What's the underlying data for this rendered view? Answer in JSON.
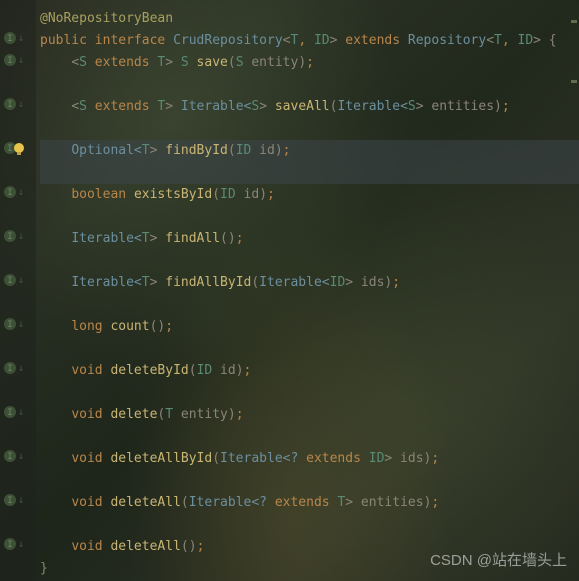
{
  "annotation": "@NoRepositoryBean",
  "decl": {
    "public": "public",
    "interface": "interface",
    "name": "CrudRepository",
    "lt": "<",
    "t": "T",
    "comma": ", ",
    "id": "ID",
    "gt": ">",
    "extends": " extends ",
    "parent": "Repository",
    "brace": " {"
  },
  "methods": {
    "save": {
      "prefix": "<",
      "s": "S",
      "ext": " extends ",
      "t": "T",
      "gt": "> ",
      "ret": "S",
      "name": " save",
      "lp": "(",
      "ptype": "S",
      "pname": " entity",
      "rp": ")",
      "semi": ";"
    },
    "saveAll": {
      "prefix": "<",
      "s": "S",
      "ext": " extends ",
      "t": "T",
      "gt": "> ",
      "ret": "Iterable<",
      "rs": "S",
      "rgt": "> ",
      "name": "saveAll",
      "lp": "(",
      "ptype": "Iterable<",
      "ps": "S",
      "pgt": ">",
      "pname": " entities",
      "rp": ")",
      "semi": ";"
    },
    "findById": {
      "ret": "Optional<",
      "t": "T",
      "gt": "> ",
      "name": "findById",
      "lp": "(",
      "ptype": "ID",
      "pname": " id",
      "rp": ")",
      "semi": ";"
    },
    "existsById": {
      "ret": "boolean ",
      "name": "existsById",
      "lp": "(",
      "ptype": "ID",
      "pname": " id",
      "rp": ")",
      "semi": ";"
    },
    "findAll": {
      "ret": "Iterable<",
      "t": "T",
      "gt": "> ",
      "name": "findAll",
      "lp": "(",
      "rp": ")",
      "semi": ";"
    },
    "findAllById": {
      "ret": "Iterable<",
      "t": "T",
      "gt": "> ",
      "name": "findAllById",
      "lp": "(",
      "ptype": "Iterable<",
      "pid": "ID",
      "pgt": ">",
      "pname": " ids",
      "rp": ")",
      "semi": ";"
    },
    "count": {
      "ret": "long ",
      "name": "count",
      "lp": "(",
      "rp": ")",
      "semi": ";"
    },
    "deleteById": {
      "ret": "void ",
      "name": "deleteById",
      "lp": "(",
      "ptype": "ID",
      "pname": " id",
      "rp": ")",
      "semi": ";"
    },
    "delete": {
      "ret": "void ",
      "name": "delete",
      "lp": "(",
      "ptype": "T",
      "pname": " entity",
      "rp": ")",
      "semi": ";"
    },
    "deleteAllById": {
      "ret": "void ",
      "name": "deleteAllById",
      "lp": "(",
      "ptype": "Iterable<? ",
      "ext": "extends ",
      "pid": "ID",
      "pgt": ">",
      "pname": " ids",
      "rp": ")",
      "semi": ";"
    },
    "deleteAll1": {
      "ret": "void ",
      "name": "deleteAll",
      "lp": "(",
      "ptype": "Iterable<? ",
      "ext": "extends ",
      "pt": "T",
      "pgt": ">",
      "pname": " entities",
      "rp": ")",
      "semi": ";"
    },
    "deleteAll2": {
      "ret": "void ",
      "name": "deleteAll",
      "lp": "(",
      "rp": ")",
      "semi": ";"
    }
  },
  "closeBrace": "}",
  "watermark": "CSDN @站在墙头上",
  "gutter": {
    "caretDown": "↓",
    "impl": "I"
  }
}
